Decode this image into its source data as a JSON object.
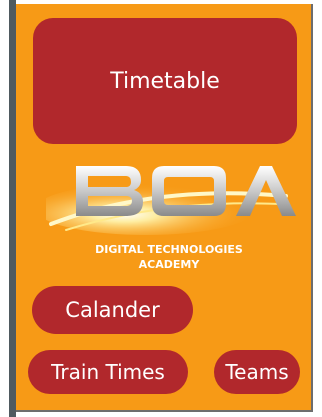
{
  "buttons": {
    "timetable_label": "Timetable",
    "calander_label": "Calander",
    "train_times_label": "Train Times",
    "teams_label": "Teams"
  },
  "logo": {
    "wordmark": "BOA",
    "caption_line1": "DIGITAL TECHNOLOGIES",
    "caption_line2": "ACADEMY"
  },
  "colors": {
    "background": "#f79a16",
    "button": "#b1282c",
    "button_text": "#ffffff",
    "side_bar": "#4f5a60"
  }
}
